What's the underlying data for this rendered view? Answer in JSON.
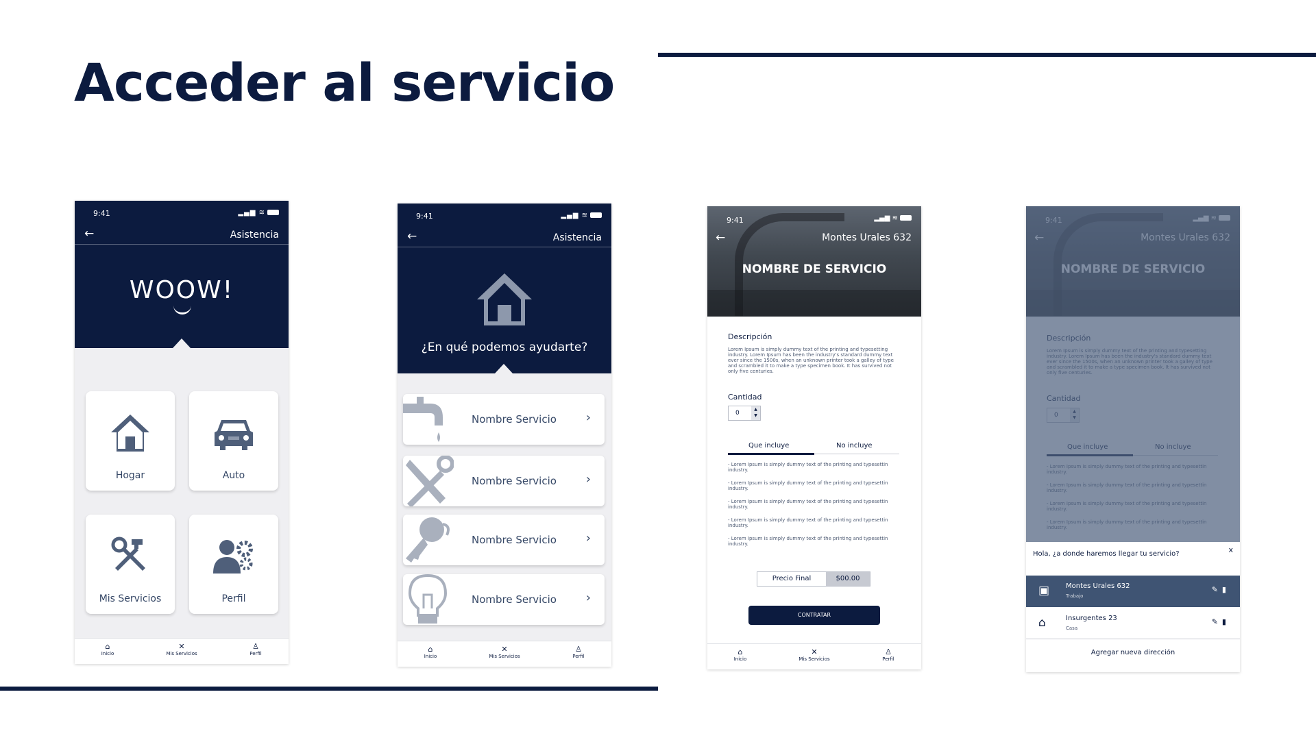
{
  "slide": {
    "title": "Acceder al servicio"
  },
  "colors": {
    "navy": "#0c1b3f",
    "light_grey": "#efeff2",
    "icon_slate": "#4f5f7a"
  },
  "status_bar": {
    "time": "9:41"
  },
  "screen1": {
    "header_title": "Asistencia",
    "logo_text": "WOOW!",
    "tiles": [
      {
        "label": "Hogar",
        "icon": "house-icon"
      },
      {
        "label": "Auto",
        "icon": "car-icon"
      },
      {
        "label": "Mis Servicios",
        "icon": "tools-icon"
      },
      {
        "label": "Perfil",
        "icon": "user-gear-icon"
      }
    ]
  },
  "tabbar": {
    "items": [
      "Inicio",
      "Mis Servicios",
      "Perfil"
    ]
  },
  "screen2": {
    "header_title": "Asistencia",
    "question": "¿En qué podemos ayudarte?",
    "services": [
      {
        "name": "Nombre Servicio",
        "icon": "faucet-icon"
      },
      {
        "name": "Nombre Servicio",
        "icon": "tools-icon"
      },
      {
        "name": "Nombre Servicio",
        "icon": "key-icon"
      },
      {
        "name": "Nombre Servicio",
        "icon": "lightbulb-icon"
      }
    ]
  },
  "screen3": {
    "address": "Montes Urales 632",
    "service_name": "NOMBRE DE SERVICIO",
    "description_label": "Descripción",
    "description_text": "Lorem Ipsum is simply dummy text of the printing and typesetting industry. Lorem Ipsum has been the industry's standard dummy text ever since the 1500s, when an unknown printer took a galley of type and scrambled it to make a type specimen book. It has survived not only five centuries.",
    "quantity_label": "Cantidad",
    "quantity_value": "0",
    "tabs": [
      "Que incluye",
      "No incluye"
    ],
    "bullets": [
      "- Lorem Ipsum is simply dummy text of the printing and typesettin industry.",
      "- Lorem Ipsum is simply dummy text of the printing and typesettin industry.",
      "- Lorem Ipsum is simply dummy text of the printing and typesettin industry.",
      "- Lorem Ipsum is simply dummy text of the printing and typesettin industry.",
      "- Lorem Ipsum is simply dummy text of the printing and typesettin industry."
    ],
    "price_label": "Precio Final",
    "price_value": "$00.00",
    "cta": "CONTRATAR"
  },
  "screen4": {
    "question": "Hola, ¿a donde haremos llegar tu servicio?",
    "close": "x",
    "addresses": [
      {
        "title": "Montes Urales 632",
        "type": "Trabajo",
        "icon": "briefcase-icon"
      },
      {
        "title": "Insurgentes 23",
        "type": "Casa",
        "icon": "home-icon"
      }
    ],
    "add_new": "Agregar nueva dirección"
  }
}
